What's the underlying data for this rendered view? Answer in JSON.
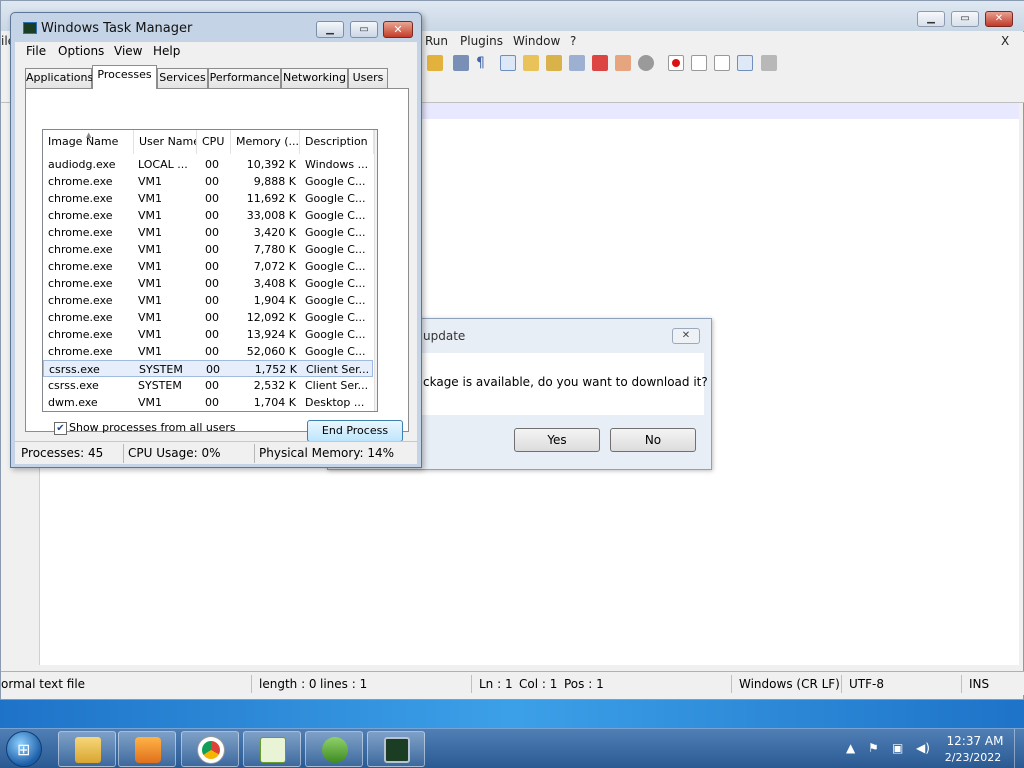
{
  "notepadpp": {
    "menu_partial_file": "ile",
    "menu_items": [
      "Run",
      "Plugins",
      "Window",
      "?"
    ],
    "menu_close": "X",
    "status": {
      "file_type": "ormal text file",
      "length": "length : 0",
      "lines": "lines : 1",
      "ln": "Ln : 1",
      "col": "Col : 1",
      "pos": "Pos : 1",
      "eol": "Windows (CR LF)",
      "encoding": "UTF-8",
      "mode": "INS"
    }
  },
  "update_dialog": {
    "title": "update",
    "message": "ckage is available, do you want to download it?",
    "yes_label": "Yes",
    "no_label": "No"
  },
  "task_manager": {
    "title": "Windows Task Manager",
    "menu": [
      "File",
      "Options",
      "View",
      "Help"
    ],
    "tabs": [
      "Applications",
      "Processes",
      "Services",
      "Performance",
      "Networking",
      "Users"
    ],
    "active_tab": "Processes",
    "columns": [
      "Image Name",
      "User Name",
      "CPU",
      "Memory (...",
      "Description"
    ],
    "rows": [
      [
        "audiodg.exe",
        "LOCAL ...",
        "00",
        "10,392 K",
        "Windows ..."
      ],
      [
        "chrome.exe",
        "VM1",
        "00",
        "9,888 K",
        "Google C..."
      ],
      [
        "chrome.exe",
        "VM1",
        "00",
        "11,692 K",
        "Google C..."
      ],
      [
        "chrome.exe",
        "VM1",
        "00",
        "33,008 K",
        "Google C..."
      ],
      [
        "chrome.exe",
        "VM1",
        "00",
        "3,420 K",
        "Google C..."
      ],
      [
        "chrome.exe",
        "VM1",
        "00",
        "7,780 K",
        "Google C..."
      ],
      [
        "chrome.exe",
        "VM1",
        "00",
        "7,072 K",
        "Google C..."
      ],
      [
        "chrome.exe",
        "VM1",
        "00",
        "3,408 K",
        "Google C..."
      ],
      [
        "chrome.exe",
        "VM1",
        "00",
        "1,904 K",
        "Google C..."
      ],
      [
        "chrome.exe",
        "VM1",
        "00",
        "12,092 K",
        "Google C..."
      ],
      [
        "chrome.exe",
        "VM1",
        "00",
        "13,924 K",
        "Google C..."
      ],
      [
        "chrome.exe",
        "VM1",
        "00",
        "52,060 K",
        "Google C..."
      ],
      [
        "csrss.exe",
        "SYSTEM",
        "00",
        "1,752 K",
        "Client Ser..."
      ],
      [
        "csrss.exe",
        "SYSTEM",
        "00",
        "2,532 K",
        "Client Ser..."
      ],
      [
        "dwm.exe",
        "VM1",
        "00",
        "1,704 K",
        "Desktop ..."
      ]
    ],
    "selected_row_index": 12,
    "show_all_label": "Show processes from all users",
    "show_all_checked": true,
    "end_process_label": "End Process",
    "status": {
      "processes": "Processes: 45",
      "cpu": "CPU Usage: 0%",
      "memory": "Physical Memory: 14%"
    }
  },
  "taskbar": {
    "apps": [
      "windows-explorer",
      "media-player",
      "chrome",
      "notepadpp",
      "downloader",
      "task-manager"
    ],
    "clock_time": "12:37 AM",
    "clock_date": "2/23/2022"
  }
}
